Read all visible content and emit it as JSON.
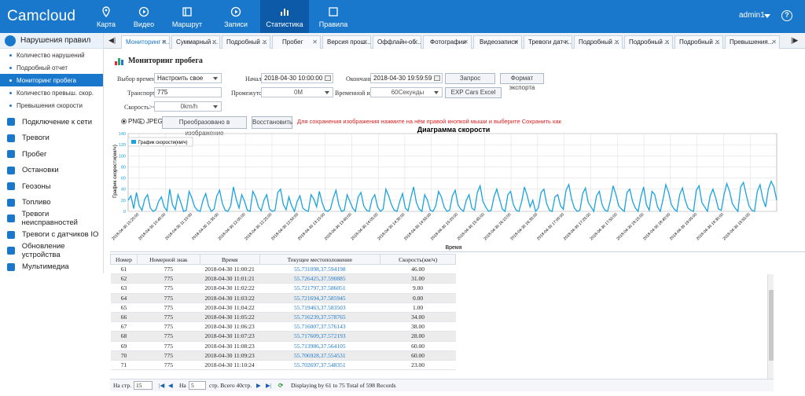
{
  "app": {
    "logo": "Camcloud",
    "user": "admin1",
    "help": "?"
  },
  "nav": [
    {
      "label": "Карта",
      "icon": "map-pin-icon"
    },
    {
      "label": "Видео",
      "icon": "video-play-icon"
    },
    {
      "label": "Маршрут",
      "icon": "route-icon"
    },
    {
      "label": "Записи",
      "icon": "record-play-icon"
    },
    {
      "label": "Статистика",
      "icon": "bar-chart-icon",
      "active": true
    },
    {
      "label": "Правила",
      "icon": "rules-doc-icon"
    }
  ],
  "sidebar": {
    "group": "Нарушения правил",
    "subitems": [
      {
        "label": "Количество нарушений"
      },
      {
        "label": "Подробный отчет"
      },
      {
        "label": "Мониторинг пробега",
        "active": true
      },
      {
        "label": "Количество превыш. скор."
      },
      {
        "label": "Превышения скорости"
      }
    ],
    "items": [
      {
        "label": "Подключение к сети"
      },
      {
        "label": "Тревоги"
      },
      {
        "label": "Пробег"
      },
      {
        "label": "Остановки"
      },
      {
        "label": "Геозоны"
      },
      {
        "label": "Топливо"
      },
      {
        "label": "Тревоги неисправностей"
      },
      {
        "label": "Тревоги с датчиков IO"
      },
      {
        "label": "Обновление устройства"
      },
      {
        "label": "Мультимедиа"
      }
    ]
  },
  "tabs": {
    "prev": "◀|",
    "next": "|▶",
    "close": "✕",
    "items": [
      {
        "label": "Мониторинг п...",
        "active": true
      },
      {
        "label": "Суммарный ..."
      },
      {
        "label": "Подробный ..."
      },
      {
        "label": "Пробег"
      },
      {
        "label": "Версия прош..."
      },
      {
        "label": "Оффлайн-об..."
      },
      {
        "label": "Фотографии"
      },
      {
        "label": "Видеозаписи"
      },
      {
        "label": "Тревоги датч..."
      },
      {
        "label": "Подробный ..."
      },
      {
        "label": "Подробный ..."
      },
      {
        "label": "Подробный ..."
      },
      {
        "label": "Превышения..."
      }
    ]
  },
  "page": {
    "title": "Мониторинг пробега"
  },
  "form": {
    "time_label": "Выбор времени:",
    "time_value": "Настроить свое",
    "start_label": "Начало:",
    "start_value": "2018-04-30 10:00:00",
    "end_label": "Окончание:",
    "end_value": "2018-04-30 19:59:59",
    "query_btn": "Запрос",
    "export_btn": "Формат экспорта",
    "vehicle_label": "Транспорт:",
    "vehicle_value": "775",
    "gap_label": "Промежуток:",
    "gap_value": "0M",
    "interval_label": "Временной инте",
    "interval_value": "60Секунды",
    "excel_btn": "EXP Cars Excel",
    "speed_label": "Скорость>=:",
    "speed_value": "0km/h",
    "png_label": "PNG",
    "jpeg_label": "JPEG",
    "convert_btn": "Преобразовано в изображение",
    "restore_btn": "Восстановить",
    "hint": "Для сохранения изображения нажмите на нём правой кнопкой мыши и выберите Сохранить как"
  },
  "chart_data": {
    "type": "line",
    "title": "Диаграмма скорости",
    "xlabel": "Время",
    "ylabel": "График скорости(км/ч)",
    "legend": "График скорости(км/ч)",
    "legend_position": "top-left",
    "grid": true,
    "color": "#1aa3e0",
    "ylim": [
      0,
      140
    ],
    "yticks": [
      0,
      20,
      40,
      60,
      80,
      100,
      120,
      140
    ],
    "xticks": [
      "2018-04-30 10:20:00",
      "2018-04-30 10:45:00",
      "2018-04-30 11:10:00",
      "2018-04-30 11:35:00",
      "2018-04-30 12:00:00",
      "2018-04-30 12:25:00",
      "2018-04-30 12:50:00",
      "2018-04-30 13:15:00",
      "2018-04-30 13:40:00",
      "2018-04-30 14:05:00",
      "2018-04-30 14:30:00",
      "2018-04-30 14:55:00",
      "2018-04-30 15:20:00",
      "2018-04-30 15:45:00",
      "2018-04-30 16:10:00",
      "2018-04-30 16:35:00",
      "2018-04-30 17:00:00",
      "2018-04-30 17:25:00",
      "2018-04-30 17:50:00",
      "2018-04-30 18:15:00",
      "2018-04-30 18:40:00",
      "2018-04-30 19:05:00",
      "2018-04-30 19:30:00",
      "2018-04-30 19:55:00"
    ],
    "values": [
      20,
      28,
      5,
      34,
      10,
      2,
      22,
      30,
      6,
      0,
      3,
      18,
      26,
      8,
      1,
      40,
      12,
      3,
      30,
      16,
      0,
      2,
      36,
      24,
      8,
      2,
      0,
      20,
      32,
      10,
      0,
      4,
      28,
      38,
      14,
      2,
      0,
      10,
      44,
      22,
      6,
      30,
      18,
      2,
      0,
      36,
      26,
      8,
      1,
      20,
      30,
      4,
      0,
      2,
      34,
      40,
      12,
      3,
      26,
      10,
      0,
      18,
      28,
      6,
      2,
      0,
      30,
      22,
      8,
      36,
      16,
      2,
      0,
      4,
      24,
      38,
      12,
      0,
      2,
      30,
      18,
      6,
      0,
      26,
      34,
      10,
      2,
      0,
      22,
      30,
      8,
      0,
      4,
      40,
      28,
      12,
      2,
      0,
      18,
      32,
      6,
      1,
      24,
      44,
      16,
      4,
      0,
      30,
      20,
      2,
      0,
      10,
      36,
      26,
      8,
      0,
      2,
      28,
      38,
      12,
      4,
      0,
      20,
      30,
      6,
      2,
      34,
      46,
      18,
      8,
      0,
      2,
      26,
      40,
      22,
      4,
      0,
      30,
      36,
      12,
      2,
      0,
      18,
      44,
      28,
      8,
      20,
      0,
      6,
      34,
      40,
      14,
      2,
      0,
      26,
      30,
      10,
      4,
      38,
      48,
      22,
      6,
      0,
      2,
      32,
      42,
      16,
      8,
      0,
      28,
      36,
      12,
      2,
      0,
      20,
      46,
      30,
      10,
      4,
      0,
      34,
      40,
      18,
      6,
      0,
      26,
      44,
      12,
      2,
      36,
      30,
      8,
      0,
      22,
      48,
      34,
      12,
      4,
      0,
      30,
      42,
      20,
      6,
      2,
      0,
      38,
      46,
      16,
      8,
      0,
      28,
      40,
      24,
      4,
      2,
      30,
      50,
      36,
      14,
      6,
      0,
      44,
      52,
      30,
      10,
      2,
      0,
      36,
      48,
      22,
      8,
      40,
      54,
      44,
      20
    ]
  },
  "table": {
    "columns": [
      "Номер",
      "Номерной знак",
      "Время",
      "Текущее местоположение",
      "Скорость(км/ч)"
    ],
    "rows": [
      [
        "61",
        "775",
        "2018-04-30 11:00:21",
        "55.731098,37.594198",
        "46.00"
      ],
      [
        "62",
        "775",
        "2018-04-30 11:01:21",
        "55.726425,37.590885",
        "31.00"
      ],
      [
        "63",
        "775",
        "2018-04-30 11:02:22",
        "55.721797,37.586051",
        "9.00"
      ],
      [
        "64",
        "775",
        "2018-04-30 11:03:22",
        "55.721694,37.585945",
        "0.00"
      ],
      [
        "65",
        "775",
        "2018-04-30 11:04:22",
        "55.719463,37.583503",
        "1.00"
      ],
      [
        "66",
        "775",
        "2018-04-30 11:05:22",
        "55.716239,37.578765",
        "34.00"
      ],
      [
        "67",
        "775",
        "2018-04-30 11:06:23",
        "55.716007,37.576143",
        "38.00"
      ],
      [
        "68",
        "775",
        "2018-04-30 11:07:23",
        "55.717609,37.572193",
        "28.00"
      ],
      [
        "69",
        "775",
        "2018-04-30 11:08:23",
        "55.713986,37.564105",
        "60.00"
      ],
      [
        "70",
        "775",
        "2018-04-30 11:09:23",
        "55.706928,37.554531",
        "60.00"
      ],
      [
        "71",
        "775",
        "2018-04-30 11:10:24",
        "55.702697,37.548351",
        "23.00"
      ]
    ]
  },
  "pager": {
    "per_page_label": "На стр.",
    "per_page": "15",
    "page_label": "На",
    "page": "5",
    "of_label": "стр. Всего 40стр.",
    "summary": "Displaying by 61 to 75 Total of 598 Records"
  }
}
